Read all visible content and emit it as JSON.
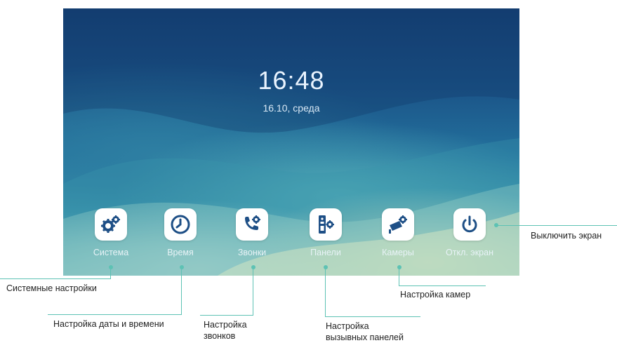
{
  "screen": {
    "time": "16:48",
    "date": "16.10, среда"
  },
  "apps": [
    {
      "label": "Система",
      "icon": "gears-icon"
    },
    {
      "label": "Время",
      "icon": "clock-icon"
    },
    {
      "label": "Звонки",
      "icon": "phone-settings-icon"
    },
    {
      "label": "Панели",
      "icon": "intercom-panel-icon"
    },
    {
      "label": "Камеры",
      "icon": "camera-settings-icon"
    },
    {
      "label": "Откл. экран",
      "icon": "power-icon"
    }
  ],
  "callouts": {
    "system": "Системные настройки",
    "time": "Настройка даты и времени",
    "calls_line1": "Настройка",
    "calls_line2": "звонков",
    "panels_line1": "Настройка",
    "panels_line2": "вызывных панелей",
    "cameras": "Настройка камер",
    "screen_off": "Выключить экран"
  },
  "colors": {
    "accent": "#1e4f86",
    "callout": "#5dc2b4"
  }
}
